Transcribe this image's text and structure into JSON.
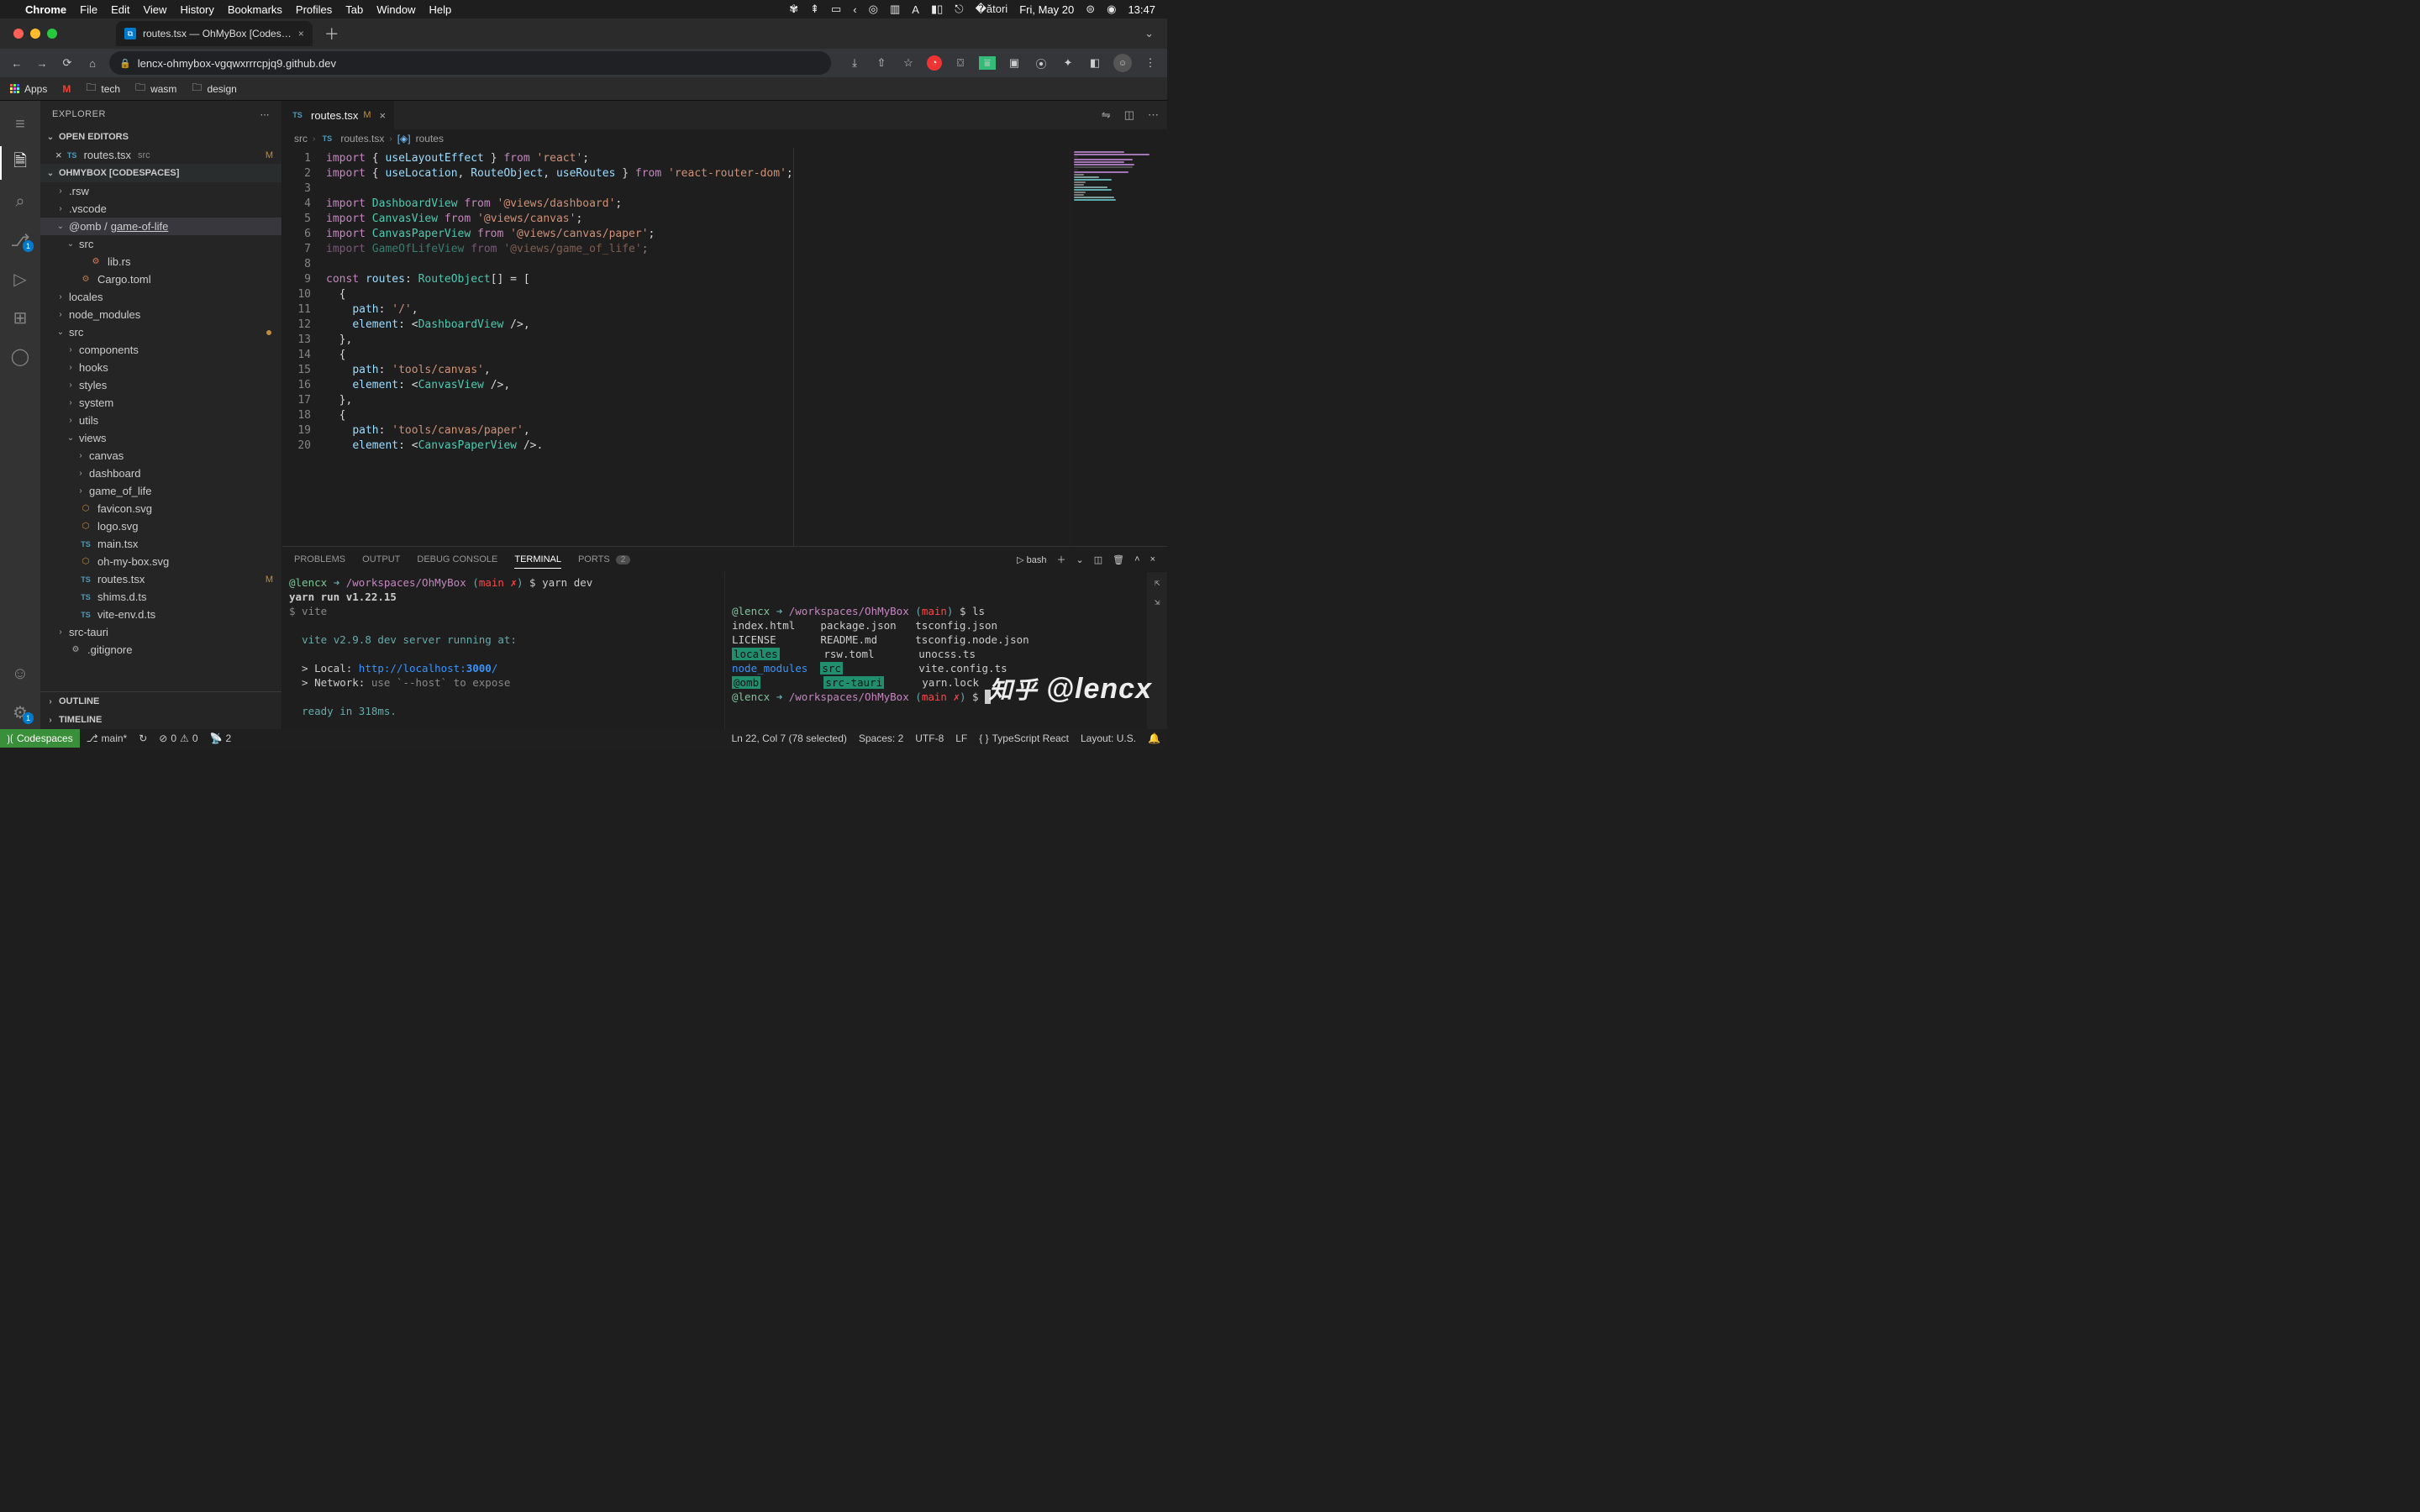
{
  "macos": {
    "app": "Chrome",
    "menu": [
      "File",
      "Edit",
      "View",
      "History",
      "Bookmarks",
      "Profiles",
      "Tab",
      "Window",
      "Help"
    ],
    "date": "Fri, May 20",
    "time": "13:47"
  },
  "browser": {
    "tab_title": "routes.tsx — OhMyBox [Codes…",
    "url": "lencx-ohmybox-vgqwxrrrcpjq9.github.dev",
    "bookmarks": [
      "Apps",
      "",
      "tech",
      "wasm",
      "design"
    ]
  },
  "explorer": {
    "title": "EXPLORER",
    "open_editors": "OPEN EDITORS",
    "open_editors_items": [
      {
        "name": "routes.tsx",
        "dir": "src",
        "mod": "M"
      }
    ],
    "workspace": "OHMYBOX [CODESPACES]",
    "tree": [
      {
        "name": ".rsw",
        "k": "folder",
        "ind": 1,
        "chev": "›"
      },
      {
        "name": ".vscode",
        "k": "folder",
        "ind": 1,
        "chev": "›"
      },
      {
        "name": "@omb / ",
        "k": "folder",
        "ind": 1,
        "chev": "⌄",
        "extra": "game-of-life",
        "sel": true
      },
      {
        "name": "src",
        "k": "folder",
        "ind": 2,
        "chev": "⌄"
      },
      {
        "name": "lib.rs",
        "k": "file",
        "ind": 3,
        "icon": "rs"
      },
      {
        "name": "Cargo.toml",
        "k": "file",
        "ind": 2,
        "icon": "toml"
      },
      {
        "name": "locales",
        "k": "folder",
        "ind": 1,
        "chev": "›"
      },
      {
        "name": "node_modules",
        "k": "folder",
        "ind": 1,
        "chev": "›"
      },
      {
        "name": "src",
        "k": "folder",
        "ind": 1,
        "chev": "⌄",
        "srcdot": true
      },
      {
        "name": "components",
        "k": "folder",
        "ind": 2,
        "chev": "›"
      },
      {
        "name": "hooks",
        "k": "folder",
        "ind": 2,
        "chev": "›"
      },
      {
        "name": "styles",
        "k": "folder",
        "ind": 2,
        "chev": "›"
      },
      {
        "name": "system",
        "k": "folder",
        "ind": 2,
        "chev": "›"
      },
      {
        "name": "utils",
        "k": "folder",
        "ind": 2,
        "chev": "›"
      },
      {
        "name": "views",
        "k": "folder",
        "ind": 2,
        "chev": "⌄"
      },
      {
        "name": "canvas",
        "k": "folder",
        "ind": 3,
        "chev": "›"
      },
      {
        "name": "dashboard",
        "k": "folder",
        "ind": 3,
        "chev": "›"
      },
      {
        "name": "game_of_life",
        "k": "folder",
        "ind": 3,
        "chev": "›"
      },
      {
        "name": "favicon.svg",
        "k": "file",
        "ind": 2,
        "icon": "svg"
      },
      {
        "name": "logo.svg",
        "k": "file",
        "ind": 2,
        "icon": "svg"
      },
      {
        "name": "main.tsx",
        "k": "file",
        "ind": 2,
        "icon": "ts"
      },
      {
        "name": "oh-my-box.svg",
        "k": "file",
        "ind": 2,
        "icon": "svg"
      },
      {
        "name": "routes.tsx",
        "k": "file",
        "ind": 2,
        "icon": "ts",
        "mod": "M"
      },
      {
        "name": "shims.d.ts",
        "k": "file",
        "ind": 2,
        "icon": "ts"
      },
      {
        "name": "vite-env.d.ts",
        "k": "file",
        "ind": 2,
        "icon": "ts"
      },
      {
        "name": "src-tauri",
        "k": "folder",
        "ind": 1,
        "chev": "›"
      },
      {
        "name": ".gitignore",
        "k": "file",
        "ind": 1,
        "icon": "file"
      }
    ],
    "outline": "OUTLINE",
    "timeline": "TIMELINE"
  },
  "editor": {
    "tab": {
      "name": "routes.tsx",
      "mod": "M"
    },
    "breadcrumbs": [
      "src",
      "routes.tsx",
      "routes"
    ],
    "code": [
      {
        "n": 1,
        "html": "<span class='kw'>import</span> <span class='pun'>{</span> <span class='var'>useLayoutEffect</span> <span class='pun'>}</span> <span class='kw'>from</span> <span class='str'>'react'</span><span class='pun'>;</span>"
      },
      {
        "n": 2,
        "html": "<span class='kw'>import</span> <span class='pun'>{</span> <span class='var'>useLocation</span><span class='pun'>,</span> <span class='var'>RouteObject</span><span class='pun'>,</span> <span class='var'>useRoutes</span> <span class='pun'>}</span> <span class='kw'>from</span> <span class='str'>'react-router-dom'</span><span class='pun'>;</span>"
      },
      {
        "n": 3,
        "html": ""
      },
      {
        "n": 4,
        "html": "<span class='kw'>import</span> <span class='cls'>DashboardView</span> <span class='kw'>from</span> <span class='str'>'@views/dashboard'</span><span class='pun'>;</span>"
      },
      {
        "n": 5,
        "html": "<span class='kw'>import</span> <span class='cls'>CanvasView</span> <span class='kw'>from</span> <span class='str'>'@views/canvas'</span><span class='pun'>;</span>"
      },
      {
        "n": 6,
        "html": "<span class='kw'>import</span> <span class='cls'>CanvasPaperView</span> <span class='kw'>from</span> <span class='str'>'@views/canvas/paper'</span><span class='pun'>;</span>"
      },
      {
        "n": 7,
        "html": "<span class='imp'><span class='kw'>import</span> <span class='cls'>GameOfLifeView</span> <span class='kw'>from</span> <span class='str'>'@views/game_of_life'</span><span class='pun'>;</span></span>"
      },
      {
        "n": 8,
        "html": ""
      },
      {
        "n": 9,
        "html": "<span class='kw'>const</span> <span class='var'>routes</span><span class='pun'>:</span> <span class='cls'>RouteObject</span><span class='pun'>[]</span> <span class='pun'>=</span> <span class='pun'>[</span>"
      },
      {
        "n": 10,
        "html": "  <span class='pun'>{</span>"
      },
      {
        "n": 11,
        "html": "    <span class='var'>path</span><span class='pun'>:</span> <span class='str'>'/'</span><span class='pun'>,</span>"
      },
      {
        "n": 12,
        "html": "    <span class='var'>element</span><span class='pun'>:</span> <span class='pun'>&lt;</span><span class='tag'>DashboardView</span> <span class='pun'>/&gt;,</span>"
      },
      {
        "n": 13,
        "html": "  <span class='pun'>},</span>"
      },
      {
        "n": 14,
        "html": "  <span class='pun'>{</span>"
      },
      {
        "n": 15,
        "html": "    <span class='var'>path</span><span class='pun'>:</span> <span class='str'>'tools/canvas'</span><span class='pun'>,</span>"
      },
      {
        "n": 16,
        "html": "    <span class='var'>element</span><span class='pun'>:</span> <span class='pun'>&lt;</span><span class='tag'>CanvasView</span> <span class='pun'>/&gt;,</span>"
      },
      {
        "n": 17,
        "html": "  <span class='pun'>},</span>"
      },
      {
        "n": 18,
        "html": "  <span class='pun'>{</span>"
      },
      {
        "n": 19,
        "html": "    <span class='var'>path</span><span class='pun'>:</span> <span class='str'>'tools/canvas/paper'</span><span class='pun'>,</span>"
      },
      {
        "n": 20,
        "html": "    <span class='var'>element</span><span class='pun'>:</span> <span class='pun'>&lt;</span><span class='tag'>CanvasPaperView</span> <span class='pun'>/&gt;.</span>"
      }
    ]
  },
  "panel": {
    "tabs": [
      "PROBLEMS",
      "OUTPUT",
      "DEBUG CONSOLE",
      "TERMINAL",
      "PORTS"
    ],
    "active": "TERMINAL",
    "ports_badge": "2",
    "shell": "bash",
    "term_left": [
      "<span class='tgreen'>@lencx</span> <span class='tcyan'>➜</span> <span class='tpurp'>/workspaces/OhMyBox</span> <span class='tcyan'>(</span><span class='tred'>main</span> <span class='tred'>✗</span><span class='tcyan'>)</span> $ yarn dev",
      "<b>yarn run v1.22.15</b>",
      "<span class='tgray'>$ vite</span>",
      "",
      "  <span class='tcyan'>vite v2.9.8 dev server running at:</span>",
      "",
      "  &gt; Local: <span class='tblue'>http://localhost:</span><span class='tblue'><b>3000</b>/</span>",
      "  &gt; Network: <span class='tgray'>use `--host` to expose</span>",
      "",
      "  <span class='tcyan'>ready in 318ms.</span>",
      "",
      "<span class='tgray'>[]</span>"
    ],
    "term_right": [
      "<span class='tgreen'>@lencx</span> <span class='tcyan'>➜</span> <span class='tpurp'>/workspaces/OhMyBox</span> <span class='tcyan'>(</span><span class='tred'>main</span><span class='tcyan'>)</span> $ ls",
      "index.html    package.json   tsconfig.json",
      "LICENSE       README.md      tsconfig.node.json",
      "<span class='thi'>locales</span>       rsw.toml       unocss.ts",
      "<span class='tblue'>node_modules</span>  <span class='thi'>src</span>            vite.config.ts",
      "<span class='thi'>@omb</span>          <span class='thi'>src-tauri</span>      yarn.lock",
      "<span class='tgreen'>@lencx</span> <span class='tcyan'>➜</span> <span class='tpurp'>/workspaces/OhMyBox</span> <span class='tcyan'>(</span><span class='tred'>main</span> <span class='tred'>✗</span><span class='tcyan'>)</span> $ <span style='background:#ccc;display:inline-block;width:7px;'>&nbsp;</span>"
    ]
  },
  "statusbar": {
    "codespaces": "Codespaces",
    "branch": "main*",
    "sync": "↻",
    "errors": "0",
    "warnings": "0",
    "radio": "2",
    "cursor": "Ln 22, Col 7 (78 selected)",
    "spaces": "Spaces: 2",
    "encoding": "UTF-8",
    "eol": "LF",
    "lang": "TypeScript React",
    "layout": "Layout: U.S."
  },
  "activity_badges": {
    "scm": "1",
    "settings": "1"
  },
  "watermark": {
    "a": "知乎",
    "b": "@lencx"
  }
}
